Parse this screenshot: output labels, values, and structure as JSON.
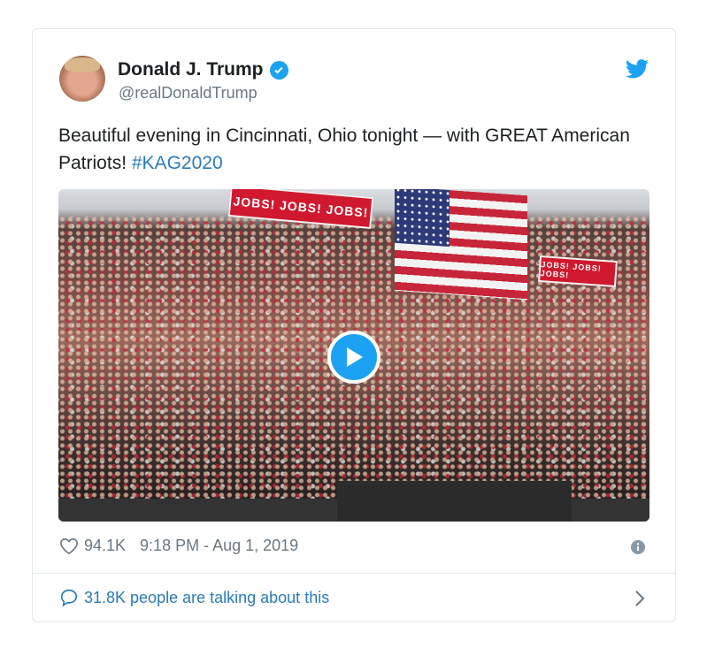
{
  "tweet": {
    "author_name": "Donald J. Trump",
    "handle": "@realDonaldTrump",
    "verified": true,
    "text": "Beautiful evening in Cincinnati, Ohio tonight — with GREAT American Patriots! ",
    "hashtag": "#KAG2020",
    "media": {
      "type": "video",
      "banner_text": "JOBS! JOBS! JOBS!",
      "icon": "play-icon"
    },
    "likes": "94.1K",
    "timestamp": "9:18 PM - Aug 1, 2019",
    "talking": "31.8K people are talking about this"
  },
  "colors": {
    "accent": "#1da1f2",
    "link": "#2b7bb9",
    "muted": "#697882"
  },
  "icons": [
    "twitter-bird-icon",
    "verified-badge-icon",
    "heart-icon",
    "info-icon",
    "comment-icon",
    "chevron-right-icon",
    "play-icon"
  ]
}
